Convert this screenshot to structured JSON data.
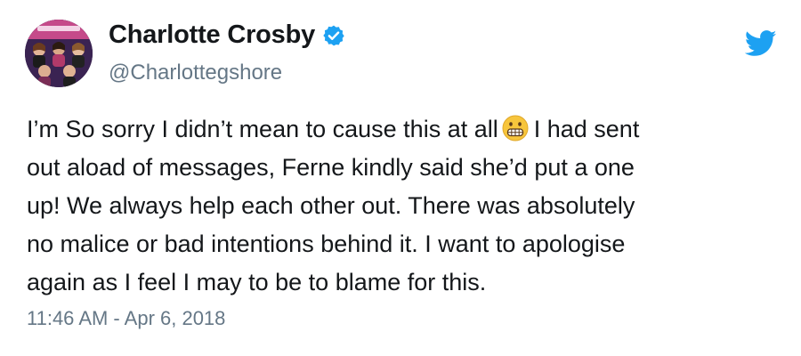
{
  "author": {
    "display_name": "Charlotte Crosby",
    "handle": "@Charlottegshore",
    "verified": true,
    "avatar_icon": "profile-photo-collage"
  },
  "tweet": {
    "line1_before_emoji": "I’m So sorry I didn’t mean to cause this at all",
    "emoji": "grimacing-face-emoji",
    "line1_after_emoji": "I had sent",
    "line2": "out aload of messages, Ferne kindly said she’d put a one",
    "line3": "up! We always help each other out. There was absolutely",
    "line4": "no malice or bad intentions behind it. I want to apologise",
    "line5": "again as I feel I may to be to blame for this.",
    "timestamp": "11:46 AM - Apr 6, 2018"
  },
  "icons": {
    "brand": "twitter-bird-icon",
    "verified": "verified-badge-icon"
  },
  "colors": {
    "text_primary": "#14171a",
    "text_secondary": "#657786",
    "twitter_blue": "#1da1f2",
    "background": "#ffffff"
  }
}
